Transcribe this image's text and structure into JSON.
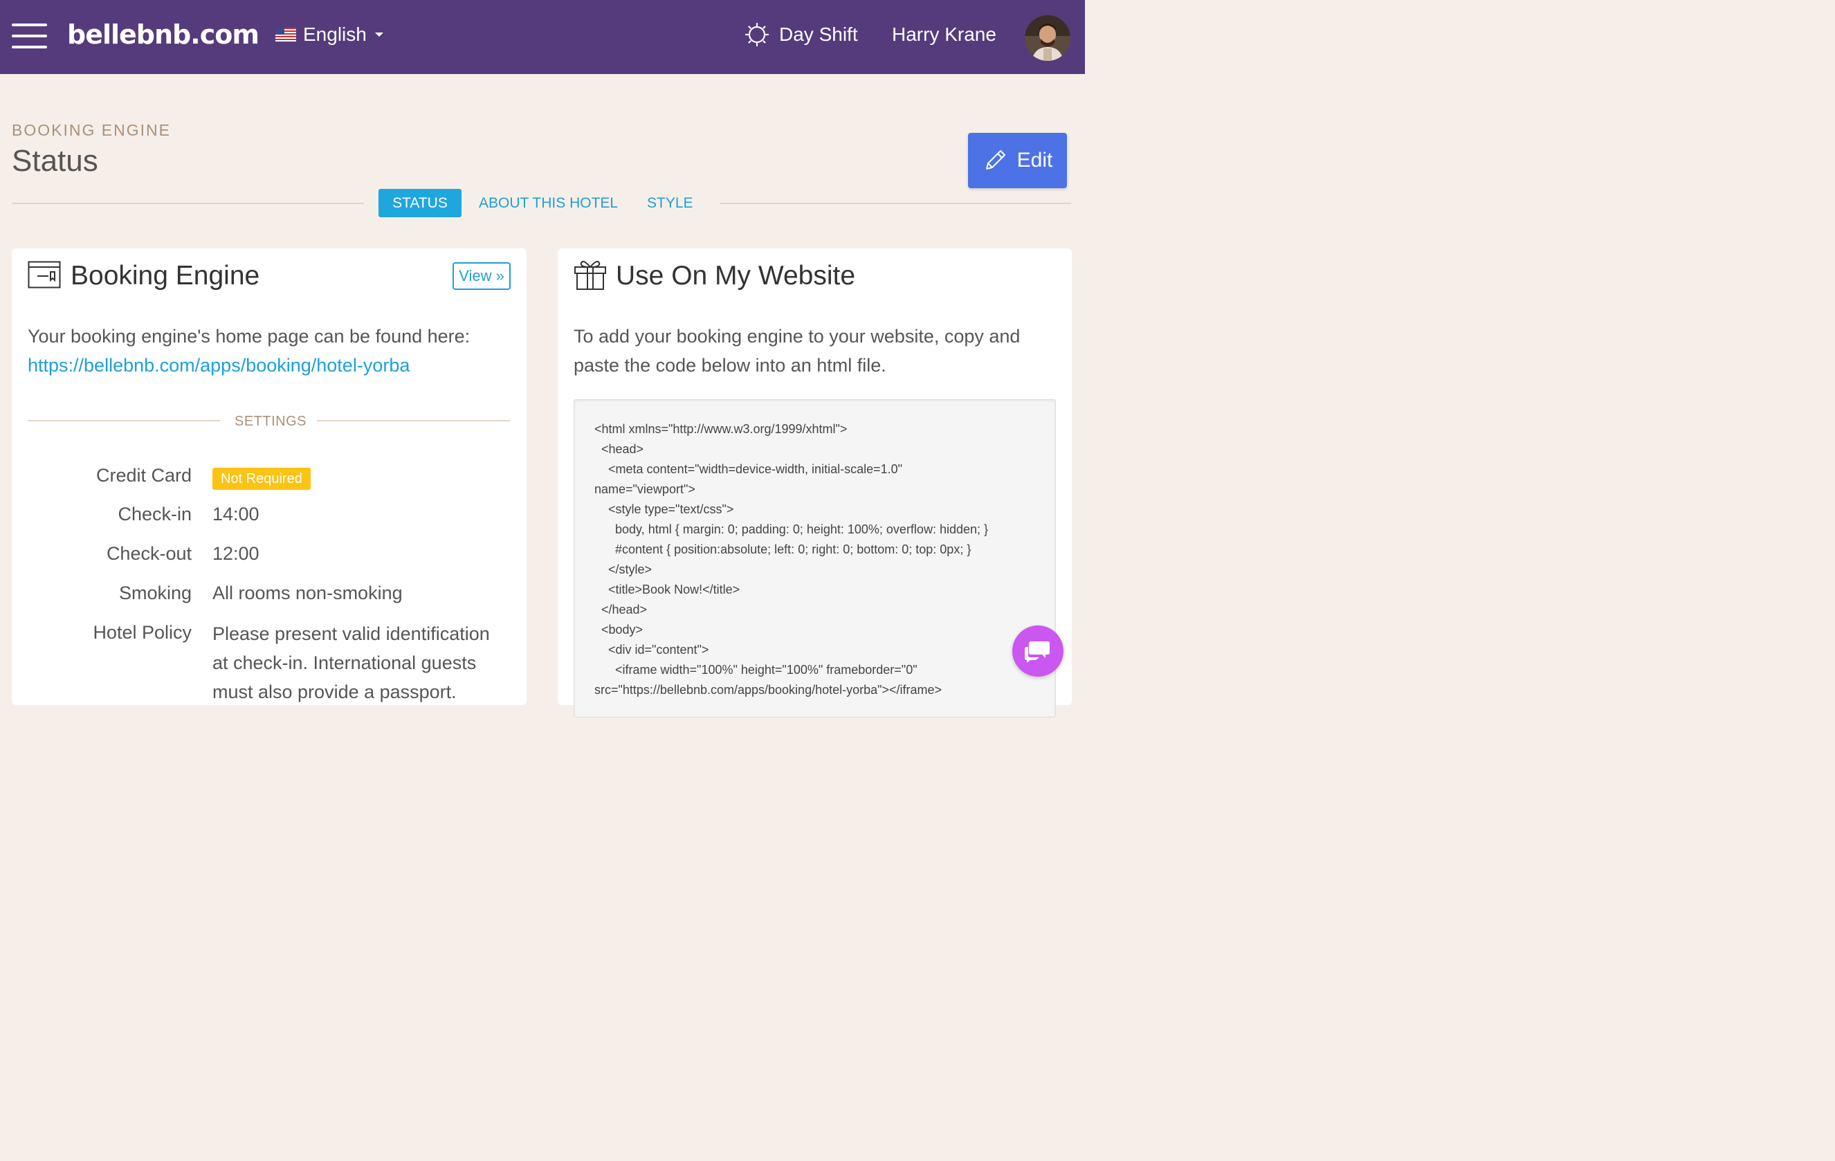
{
  "topbar": {
    "brand": "bellebnb.com",
    "language": "English",
    "shift": "Day Shift",
    "user_name": "Harry Krane"
  },
  "header": {
    "section": "BOOKING ENGINE",
    "title": "Status",
    "edit_label": "Edit"
  },
  "tabs": [
    {
      "label": "STATUS",
      "active": true
    },
    {
      "label": "ABOUT THIS HOTEL",
      "active": false
    },
    {
      "label": "STYLE",
      "active": false
    }
  ],
  "booking_card": {
    "title": "Booking Engine",
    "view_label": "View »",
    "intro": "Your booking engine's home page can be found here:",
    "url": "https://bellebnb.com/apps/booking/hotel-yorba",
    "settings_heading": "SETTINGS",
    "settings": {
      "credit_card_label": "Credit Card",
      "credit_card_value": "Not Required",
      "checkin_label": "Check-in",
      "checkin_value": "14:00",
      "checkout_label": "Check-out",
      "checkout_value": "12:00",
      "smoking_label": "Smoking",
      "smoking_value": "All rooms non-smoking",
      "policy_label": "Hotel Policy",
      "policy_line1": "Please present valid identification",
      "policy_line2": "at check-in. International guests",
      "policy_line3": "must also provide a passport."
    }
  },
  "website_card": {
    "title": "Use On My Website",
    "intro_line1": "To add your booking engine to your website, copy and",
    "intro_line2": "paste the code below into an html file.",
    "code": [
      "<html xmlns=\"http://www.w3.org/1999/xhtml\">",
      "  <head>",
      "    <meta content=\"width=device-width, initial-scale=1.0\"",
      "name=\"viewport\">",
      "    <style type=\"text/css\">",
      "      body, html { margin: 0; padding: 0; height: 100%; overflow: hidden; }",
      "      #content { position:absolute; left: 0; right: 0; bottom: 0; top: 0px; }",
      "    </style>",
      "    <title>Book Now!</title>",
      "  </head>",
      "  <body>",
      "    <div id=\"content\">",
      "      <iframe width=\"100%\" height=\"100%\" frameborder=\"0\"",
      "src=\"https://bellebnb.com/apps/booking/hotel-yorba\"></iframe>"
    ]
  },
  "colors": {
    "topbar": "#553b7c",
    "accent": "#1e9fd8",
    "edit_button": "#4c72e6",
    "badge": "#fbc313",
    "chat": "#c957f0",
    "background": "#f6efe9"
  },
  "icons": [
    "menu-icon",
    "us-flag-icon",
    "chevron-down-icon",
    "sun-icon",
    "pencil-icon",
    "booking-window-icon",
    "gift-icon",
    "chat-icon"
  ]
}
